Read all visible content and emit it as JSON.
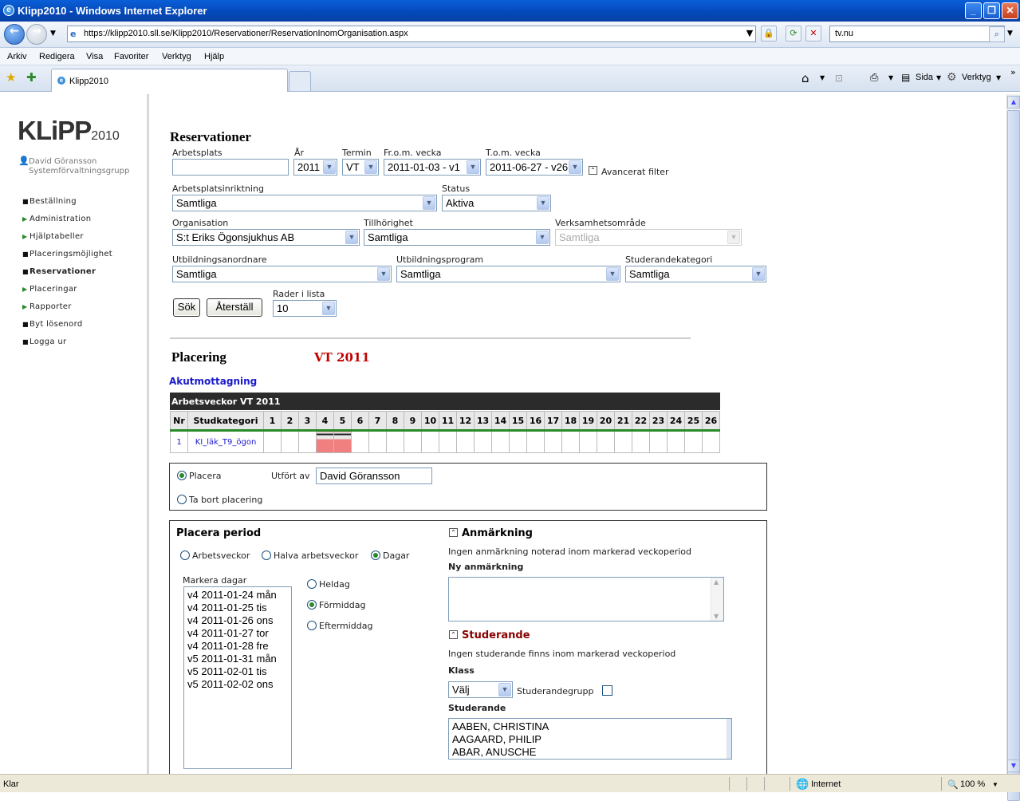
{
  "window": {
    "title": "Klipp2010 - Windows Internet Explorer",
    "url": "https://klipp2010.sll.se/Klipp2010/Reservationer/ReservationInomOrganisation.aspx",
    "search_value": "tv.nu"
  },
  "menu": [
    "Arkiv",
    "Redigera",
    "Visa",
    "Favoriter",
    "Verktyg",
    "Hjälp"
  ],
  "tabs": {
    "active": "Klipp2010",
    "toolbar_right": [
      "Sida",
      "Verktyg"
    ]
  },
  "sidebar": {
    "logo_main": "KLiPP",
    "logo_year": "2010",
    "user_name": "David Göransson",
    "user_group": "Systemförvaltningsgrupp",
    "items": [
      {
        "label": "Beställning",
        "marker": "square"
      },
      {
        "label": "Administration",
        "marker": "arrow"
      },
      {
        "label": "Hjälptabeller",
        "marker": "arrow"
      },
      {
        "label": "Placeringsmöjlighet",
        "marker": "square"
      },
      {
        "label": "Reservationer",
        "marker": "square",
        "active": true
      },
      {
        "label": "Placeringar",
        "marker": "arrow"
      },
      {
        "label": "Rapporter",
        "marker": "arrow"
      },
      {
        "label": "Byt lösenord",
        "marker": "square"
      },
      {
        "label": "Logga ur",
        "marker": "square"
      }
    ]
  },
  "filters": {
    "heading": "Reservationer",
    "arbetsplats": {
      "label": "Arbetsplats",
      "value": ""
    },
    "ar": {
      "label": "År",
      "value": "2011"
    },
    "termin": {
      "label": "Termin",
      "value": "VT"
    },
    "from_vecka": {
      "label": "Fr.o.m. vecka",
      "value": "2011-01-03 - v1"
    },
    "tom_vecka": {
      "label": "T.o.m. vecka",
      "value": "2011-06-27 - v26"
    },
    "advanced_filter": "Avancerat filter",
    "inriktning": {
      "label": "Arbetsplatsinriktning",
      "value": "Samtliga"
    },
    "status": {
      "label": "Status",
      "value": "Aktiva"
    },
    "organisation": {
      "label": "Organisation",
      "value": "S:t Eriks Ögonsjukhus AB"
    },
    "tillhorighet": {
      "label": "Tillhörighet",
      "value": "Samtliga"
    },
    "verksamhetsomrade": {
      "label": "Verksamhetsområde",
      "value": "Samtliga"
    },
    "utbildningsanordnare": {
      "label": "Utbildningsanordnare",
      "value": "Samtliga"
    },
    "utbildningsprogram": {
      "label": "Utbildningsprogram",
      "value": "Samtliga"
    },
    "studerandekategori": {
      "label": "Studerandekategori",
      "value": "Samtliga"
    },
    "rader": {
      "label": "Rader i lista",
      "value": "10"
    },
    "search_button": "Sök",
    "reset_button": "Återställ"
  },
  "placering": {
    "heading": "Placering",
    "term": "VT 2011",
    "unit": "Akutmottagning",
    "grid_title": "Arbetsveckor VT 2011",
    "col_nr": "Nr",
    "col_kategori": "Studkategori",
    "weeks": [
      "1",
      "2",
      "3",
      "4",
      "5",
      "6",
      "7",
      "8",
      "9",
      "10",
      "11",
      "12",
      "13",
      "14",
      "15",
      "16",
      "17",
      "18",
      "19",
      "20",
      "21",
      "22",
      "23",
      "24",
      "25",
      "26"
    ],
    "rows": [
      {
        "nr": "1",
        "kategori": "KI_läk_T9_ögon",
        "booked_weeks": [
          "4",
          "5"
        ]
      }
    ]
  },
  "action": {
    "placera": "Placera",
    "ta_bort": "Ta bort placering",
    "utfort_av_label": "Utfört av",
    "utfort_av_value": "David Göransson",
    "selected": "placera"
  },
  "period": {
    "heading": "Placera period",
    "modes": [
      "Arbetsveckor",
      "Halva arbetsveckor",
      "Dagar"
    ],
    "selected_mode": "Dagar",
    "markera_label": "Markera dagar",
    "days": [
      "v4 2011-01-24 mån",
      "v4 2011-01-25 tis",
      "v4 2011-01-26 ons",
      "v4 2011-01-27 tor",
      "v4 2011-01-28 fre",
      "v5 2011-01-31 mån",
      "v5 2011-02-01 tis",
      "v5 2011-02-02 ons"
    ],
    "day_parts": [
      "Heldag",
      "Förmiddag",
      "Eftermiddag"
    ],
    "selected_part": "Förmiddag"
  },
  "notes": {
    "anmarkning_heading": "Anmärkning",
    "anmarkning_text": "Ingen anmärkning noterad inom markerad veckoperiod",
    "ny_anmarkning": "Ny anmärkning",
    "studerande_heading": "Studerande",
    "studerande_text": "Ingen studerande finns inom markerad veckoperiod",
    "klass_label": "Klass",
    "klass_value": "Välj",
    "grupp_label": "Studerandegrupp",
    "studerande_label": "Studerande",
    "students": [
      "AABEN, CHRISTINA",
      "AAGAARD, PHILIP",
      "ABAR, ANUSCHE"
    ]
  },
  "statusbar": {
    "left": "Klar",
    "zone": "Internet",
    "zoom": "100 %"
  }
}
